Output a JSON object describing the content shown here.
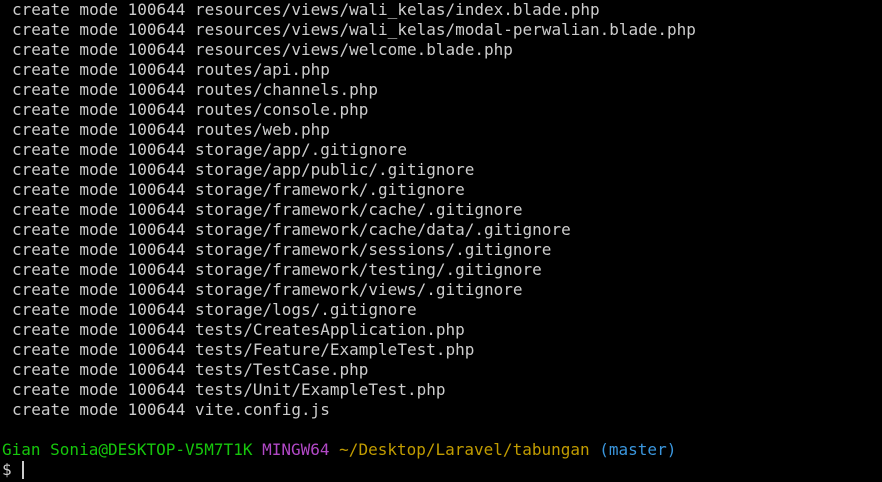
{
  "output_lines": [
    "create mode 100644 resources/views/wali_kelas/index.blade.php",
    "create mode 100644 resources/views/wali_kelas/modal-perwalian.blade.php",
    "create mode 100644 resources/views/welcome.blade.php",
    "create mode 100644 routes/api.php",
    "create mode 100644 routes/channels.php",
    "create mode 100644 routes/console.php",
    "create mode 100644 routes/web.php",
    "create mode 100644 storage/app/.gitignore",
    "create mode 100644 storage/app/public/.gitignore",
    "create mode 100644 storage/framework/.gitignore",
    "create mode 100644 storage/framework/cache/.gitignore",
    "create mode 100644 storage/framework/cache/data/.gitignore",
    "create mode 100644 storage/framework/sessions/.gitignore",
    "create mode 100644 storage/framework/testing/.gitignore",
    "create mode 100644 storage/framework/views/.gitignore",
    "create mode 100644 storage/logs/.gitignore",
    "create mode 100644 tests/CreatesApplication.php",
    "create mode 100644 tests/Feature/ExampleTest.php",
    "create mode 100644 tests/TestCase.php",
    "create mode 100644 tests/Unit/ExampleTest.php",
    "create mode 100644 vite.config.js"
  ],
  "prompt": {
    "user_host": "Gian Sonia@DESKTOP-V5M7T1K",
    "shell": "MINGW64",
    "cwd": "~/Desktop/Laravel/tabungan",
    "branch": "(master)",
    "symbol": "$",
    "input": ""
  },
  "colors": {
    "background": "#000000",
    "text": "#cccccc",
    "user_host": "#16c60c",
    "shell": "#b148c6",
    "cwd": "#c19c00",
    "branch": "#3a96dd"
  }
}
